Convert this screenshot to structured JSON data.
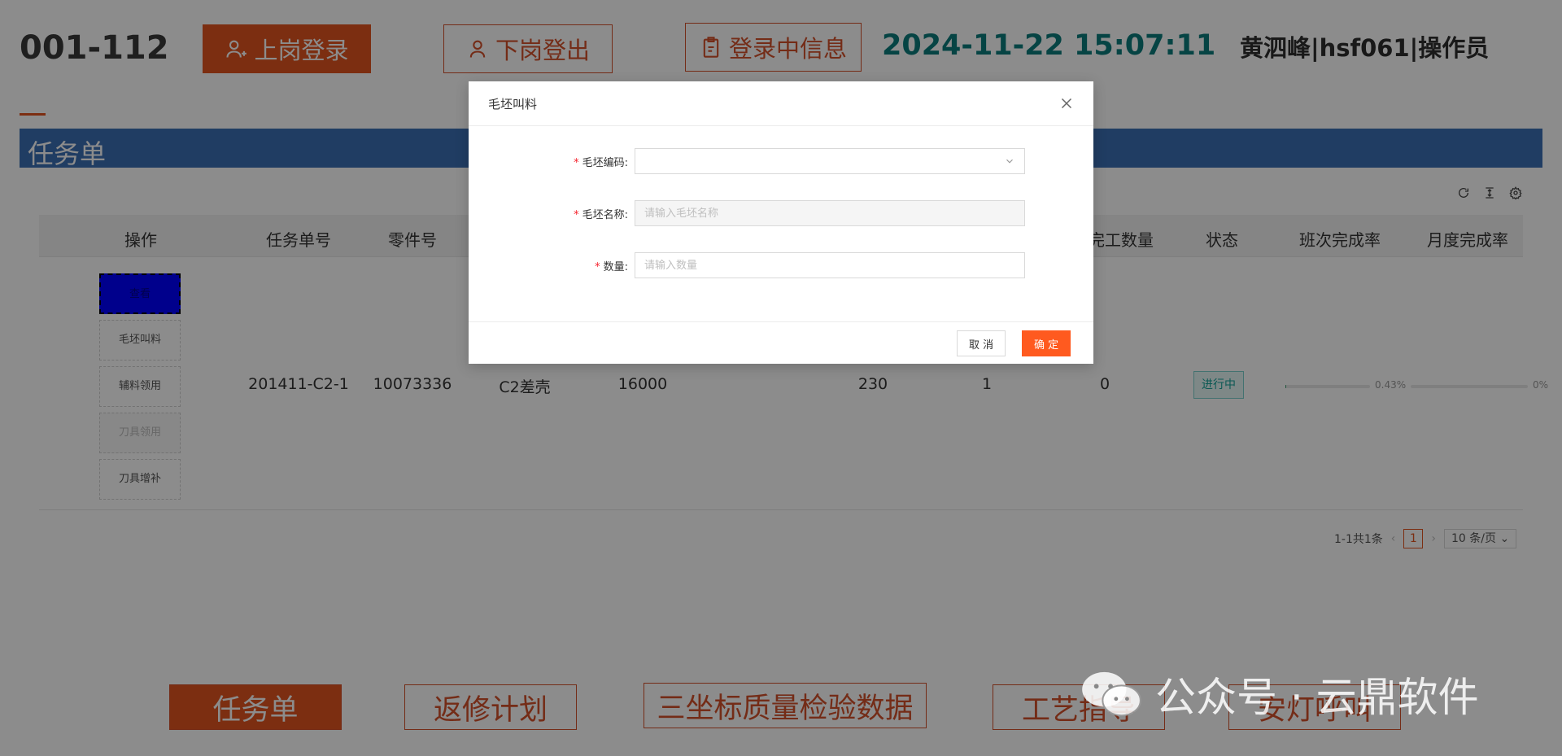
{
  "header": {
    "station_code": "001-112",
    "btn_login": "上岗登录",
    "btn_logout": "下岗登出",
    "btn_login_info": "登录中信息",
    "datetime": "2024-11-22 15:07:11",
    "user": "黄泗峰|hsf061|操作员",
    "accent_color": "#e2541f"
  },
  "section": {
    "title": "任务单"
  },
  "table": {
    "headers": [
      "操作",
      "任务单号",
      "零件号",
      "完工数量",
      "状态",
      "班次完成率",
      "月度完成率"
    ],
    "ops": [
      "查看",
      "毛坯叫料",
      "辅料领用",
      "刀具领用",
      "刀具增补"
    ],
    "row": {
      "task_no": "201411-C2-1",
      "part_no": "10073336",
      "part_name": "C2差壳",
      "qty": "16000",
      "col5": "230",
      "col6": "1",
      "completed": "0",
      "status": "进行中",
      "shift_rate_text": "0.43%",
      "shift_rate": 0.0043,
      "month_rate_text": "0%",
      "month_rate": 0
    }
  },
  "pagination": {
    "summary": "1-1共1条",
    "current": "1",
    "page_size": "10 条/页"
  },
  "bottom_nav": [
    "任务单",
    "返修计划",
    "三坐标质量检验数据",
    "工艺指导",
    "安灯呼叫"
  ],
  "modal": {
    "title": "毛坯叫料",
    "fields": {
      "code_label": "毛坯编码:",
      "name_label": "毛坯名称:",
      "name_placeholder": "请输入毛坯名称",
      "qty_label": "数量:",
      "qty_placeholder": "请输入数量"
    },
    "cancel": "取 消",
    "ok": "确 定"
  },
  "watermark": "公众号 · 云鼎软件"
}
